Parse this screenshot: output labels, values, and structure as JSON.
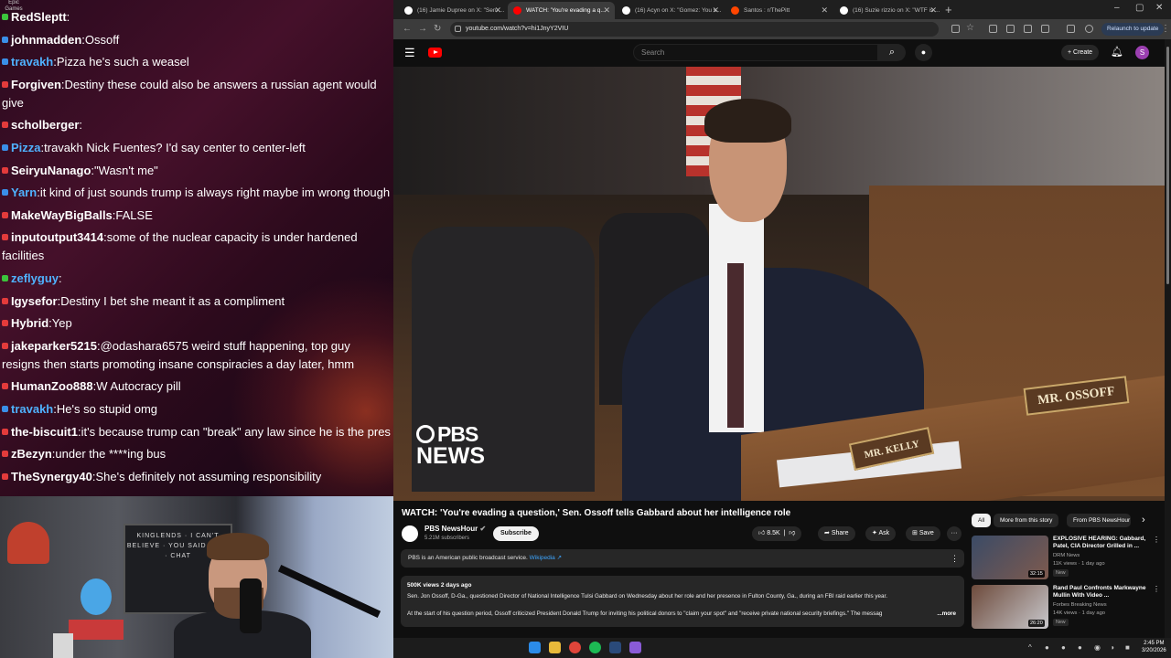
{
  "stream_overlay": {
    "epic_tag": "Epic Games",
    "chat": [
      {
        "user": "RedSleptt",
        "msg": "",
        "user_color": "#ffffff",
        "dot_color": "#3cc43c"
      },
      {
        "user": "johnmadden",
        "msg": "Ossoff",
        "user_color": "#ffffff",
        "dot_color": "#3a8fe8"
      },
      {
        "user": "travakh",
        "msg": "Pizza he's such a weasel",
        "user_color": "#4fb2ff",
        "dot_color": "#3a8fe8"
      },
      {
        "user": "Forgiven",
        "msg": "Destiny these could also be answers a russian agent would give",
        "user_color": "#ffffff",
        "dot_color": "#e33b3b"
      },
      {
        "user": "scholberger",
        "msg": "",
        "user_color": "#ffffff",
        "dot_color": "#e33b3b"
      },
      {
        "user": "Pizza",
        "msg": "travakh Nick Fuentes? I'd say center to center-left",
        "user_color": "#4fb2ff",
        "dot_color": "#3a8fe8"
      },
      {
        "user": "SeiryuNanago",
        "msg": "\"Wasn't me\"",
        "user_color": "#ffffff",
        "dot_color": "#e33b3b"
      },
      {
        "user": "Yarn",
        "msg": "it kind of just sounds  trump is always right maybe im wrong though",
        "user_color": "#4fb2ff",
        "dot_color": "#3a8fe8"
      },
      {
        "user": "MakeWayBigBalls",
        "msg": "FALSE",
        "user_color": "#ffffff",
        "dot_color": "#e33b3b"
      },
      {
        "user": "inputoutput3414",
        "msg": "some of the nuclear capacity is under hardened facilities",
        "user_color": "#ffffff",
        "dot_color": "#e33b3b"
      },
      {
        "user": "zeflyguy",
        "msg": "",
        "user_color": "#4fb2ff",
        "dot_color": "#3cc43c"
      },
      {
        "user": "Igysefor",
        "msg": "Destiny  I bet she meant it as a compliment",
        "user_color": "#ffffff",
        "dot_color": "#e33b3b"
      },
      {
        "user": "Hybrid",
        "msg": "Yep",
        "user_color": "#ffffff",
        "dot_color": "#e33b3b"
      },
      {
        "user": "jakeparker5215",
        "msg": "@odashara6575 weird stuff happening, top guy resigns then starts promoting insane conspiracies a day later, hmm",
        "user_color": "#ffffff",
        "dot_color": "#e33b3b"
      },
      {
        "user": "HumanZoo888",
        "msg": "W Autocracy pill",
        "user_color": "#ffffff",
        "dot_color": "#e33b3b"
      },
      {
        "user": "travakh",
        "msg": "He's so stupid omg",
        "user_color": "#4fb2ff",
        "dot_color": "#3a8fe8"
      },
      {
        "user": "the-biscuit1",
        "msg": "it's because trump can \"break\" any law since he is the pres",
        "user_color": "#ffffff",
        "dot_color": "#e33b3b"
      },
      {
        "user": "zBezyn",
        "msg": "under the ****ing bus",
        "user_color": "#ffffff",
        "dot_color": "#e33b3b"
      },
      {
        "user": "TheSynergy40",
        "msg": "She's definitely not assuming responsibility",
        "user_color": "#ffffff",
        "dot_color": "#e33b3b"
      }
    ],
    "webcam_board_text": "KINGLENDS · I CAN'T BELIEVE · YOU SAID THAT · CHAT"
  },
  "browser": {
    "tabs": [
      {
        "title": "(16) Jamie Dupree on X: \"Sen. ...",
        "active": false,
        "favicon_color": "#ffffff"
      },
      {
        "title": "WATCH: 'You're evading a q...",
        "active": true,
        "favicon_color": "#ff0000"
      },
      {
        "title": "(16) Acyn on X: \"Gomez: You s...",
        "active": false,
        "favicon_color": "#ffffff"
      },
      {
        "title": "Santos : r/ThePitt",
        "active": false,
        "favicon_color": "#ff4500"
      },
      {
        "title": "(16) Suzie rizzio on X: \"WTF is ...",
        "active": false,
        "favicon_color": "#ffffff"
      }
    ],
    "url": "youtube.com/watch?v=hi1JnyY2VIU",
    "relaunch_label": "Relaunch to update"
  },
  "youtube": {
    "search_placeholder": "Search",
    "create_label": "Create",
    "avatar_letter": "S",
    "player": {
      "nameplate_main": "MR. OSSOFF",
      "nameplate_secondary": "MR. KELLY",
      "watermark_line1": "PBS",
      "watermark_line2": "NEWS"
    },
    "video_title": "WATCH: 'You're evading a question,' Sen. Ossoff tells Gabbard about her intelligence role",
    "channel": {
      "name": "PBS NewsHour",
      "subs": "5.21M subscribers",
      "subscribe_label": "Subscribe"
    },
    "actions": {
      "likes": "8.5K",
      "share": "Share",
      "ask": "Ask",
      "save": "Save"
    },
    "info_panel": {
      "text": "PBS is an American public broadcast service.",
      "link": "Wikipedia"
    },
    "description": {
      "stats": "500K views  2 days ago",
      "line1": "Sen. Jon Ossoff, D-Ga., questioned Director of National Intelligence Tulsi Gabbard on Wednesday about her role and her presence in Fulton County, Ga., during an FBI raid earlier this year.",
      "line2": "At the start of his question period, Ossoff criticized President Donald Trump for inviting his political donors to \"claim your spot\" and \"receive private national security briefings.\" The messag",
      "more": "...more"
    },
    "chips": [
      "All",
      "More from this story",
      "From PBS NewsHour"
    ],
    "recommendations": [
      {
        "title": "EXPLOSIVE HEARING: Gabbard, Patel, CIA Director Grilled in ...",
        "channel": "DRM News",
        "views": "11K views · 1 day ago",
        "badge": "New",
        "duration": "32:15"
      },
      {
        "title": "Rand Paul Confronts Markwayne Mullin With Video ...",
        "channel": "Forbes Breaking News",
        "views": "14K views · 1 day ago",
        "badge": "New",
        "duration": "26:20"
      }
    ]
  },
  "taskbar": {
    "time": "2:45 PM",
    "date": "3/20/2026"
  }
}
